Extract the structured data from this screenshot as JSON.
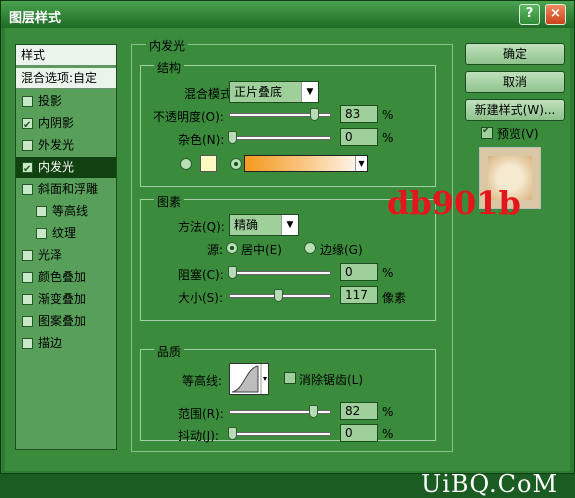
{
  "window": {
    "title": "图层样式",
    "help": "?",
    "close": "×"
  },
  "left_panel": {
    "header": "样式",
    "blend_options": "混合选项:自定",
    "items": [
      {
        "label": "投影",
        "checked": false,
        "sub": false
      },
      {
        "label": "内阴影",
        "checked": true,
        "sub": false
      },
      {
        "label": "外发光",
        "checked": false,
        "sub": false
      },
      {
        "label": "内发光",
        "checked": true,
        "sub": false,
        "selected": true
      },
      {
        "label": "斜面和浮雕",
        "checked": false,
        "sub": false
      },
      {
        "label": "等高线",
        "checked": false,
        "sub": true
      },
      {
        "label": "纹理",
        "checked": false,
        "sub": true
      },
      {
        "label": "光泽",
        "checked": false,
        "sub": false
      },
      {
        "label": "颜色叠加",
        "checked": false,
        "sub": false
      },
      {
        "label": "渐变叠加",
        "checked": false,
        "sub": false
      },
      {
        "label": "图案叠加",
        "checked": false,
        "sub": false
      },
      {
        "label": "描边",
        "checked": false,
        "sub": false
      }
    ]
  },
  "inner_glow": {
    "title": "内发光",
    "structure": {
      "title": "结构",
      "blend_mode_label": "混合模式:",
      "blend_mode_value": "正片叠底",
      "opacity_label": "不透明度(O):",
      "opacity_value": "83",
      "opacity_unit": "%",
      "noise_label": "杂色(N):",
      "noise_value": "0",
      "noise_unit": "%"
    },
    "elements": {
      "title": "图素",
      "method_label": "方法(Q):",
      "method_value": "精确",
      "source_label": "源:",
      "center_label": "居中(E)",
      "edge_label": "边缘(G)",
      "choke_label": "阻塞(C):",
      "choke_value": "0",
      "choke_unit": "%",
      "size_label": "大小(S):",
      "size_value": "117",
      "size_unit": "像素"
    },
    "quality": {
      "title": "品质",
      "contour_label": "等高线:",
      "antialias_label": "消除锯齿(L)",
      "range_label": "范围(R):",
      "range_value": "82",
      "range_unit": "%",
      "jitter_label": "抖动(J):",
      "jitter_value": "0",
      "jitter_unit": "%"
    },
    "colors": {
      "swatch": "#fff9c2",
      "gradient_start": "#f59a1f",
      "gradient_end": "#ffffff"
    }
  },
  "right_panel": {
    "ok": "确定",
    "cancel": "取消",
    "new_style": "新建样式(W)...",
    "preview_label": "预览(V)",
    "preview_checked": true
  },
  "watermark": "db901b",
  "site_logo": "UiBQ.CoM"
}
